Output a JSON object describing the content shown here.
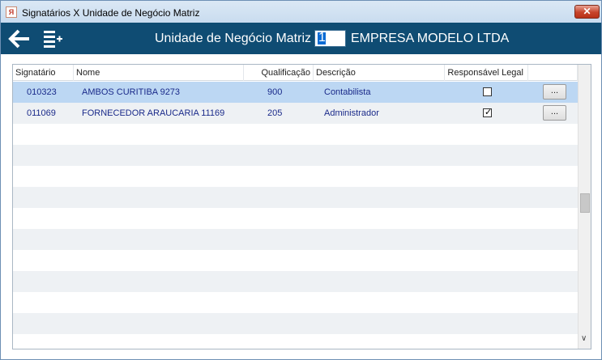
{
  "window": {
    "title": "Signatários X Unidade de Negócio Matriz",
    "app_icon_glyph": "Я",
    "close_glyph": "✕"
  },
  "toolbar": {
    "unit_label": "Unidade de Negócio Matriz",
    "unit_value": "1",
    "company_name": "EMPRESA MODELO LTDA",
    "back_icon": "arrow-left-icon",
    "menu_icon": "list-add-icon"
  },
  "grid": {
    "columns": [
      "Signatário",
      "Nome",
      "Qualificação",
      "Descrição",
      "Responsável Legal"
    ],
    "rows": [
      {
        "signatario": "010323",
        "nome": "AMBOS CURITIBA 9273",
        "qualificacao": "900",
        "descricao": "Contabilista",
        "responsavel_legal": false,
        "action": "..."
      },
      {
        "signatario": "011069",
        "nome": "FORNECEDOR ARAUCARIA 11169",
        "qualificacao": "205",
        "descricao": "Administrador",
        "responsavel_legal": true,
        "action": "..."
      }
    ],
    "scroll_down_glyph": "∨"
  },
  "colors": {
    "toolbar_bg": "#0f4c73",
    "selected_row": "#bcd7f3",
    "alt_row": "#eef1f4",
    "text_blue": "#1a2a8a"
  }
}
